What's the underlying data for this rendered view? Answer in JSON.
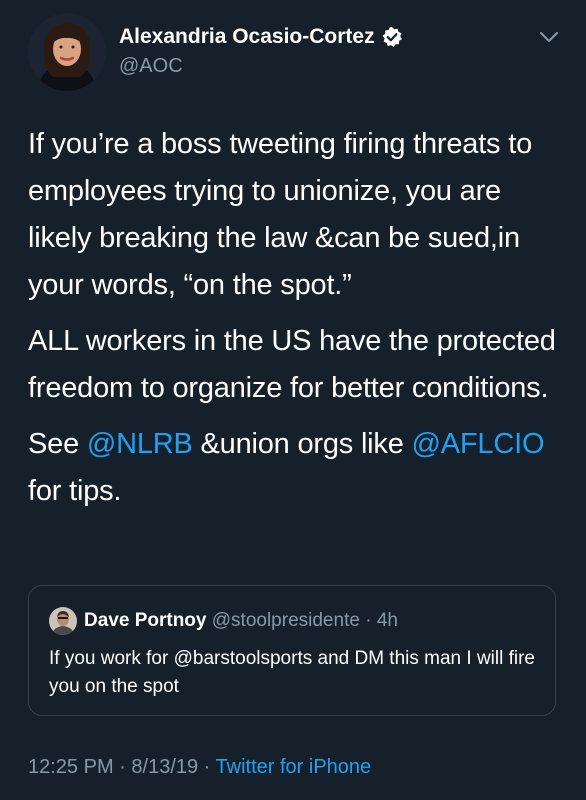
{
  "author": {
    "name": "Alexandria Ocasio-Cortez",
    "handle": "@AOC",
    "verified": true
  },
  "tweet": {
    "paragraph1": "If you’re a boss tweeting firing threats to employees trying to unionize, you are likely breaking the law &can be sued,in your words, “on the spot.”",
    "paragraph2": "ALL workers in the US have the protected freedom to organize for better conditions.",
    "paragraph3": {
      "prefix": "See ",
      "mention1": "@NLRB",
      "middle": " &union orgs like ",
      "mention2": "@AFLCIO",
      "suffix": " for tips."
    }
  },
  "quoted_tweet": {
    "name": "Dave Portnoy",
    "handle": "@stoolpresidente",
    "separator": " · ",
    "age": "4h",
    "text": "If you work for @barstoolsports and DM this man I will fire you on the spot"
  },
  "footer": {
    "time": "12:25 PM",
    "separator1": " · ",
    "date": "8/13/19",
    "separator2": " · ",
    "source": "Twitter for iPhone"
  },
  "colors": {
    "background": "#15202b",
    "primary_text": "#ffffff",
    "secondary_text": "#8899a6",
    "link": "#1da1f2",
    "border": "#38444d"
  },
  "icons": {
    "verified": "verified-badge-icon",
    "menu": "chevron-down-icon"
  }
}
